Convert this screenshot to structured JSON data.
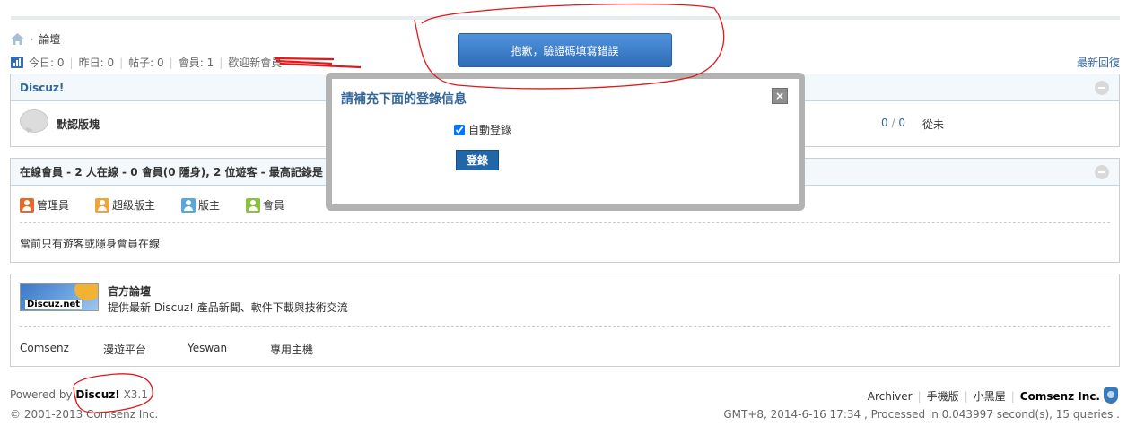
{
  "breadcrumb": {
    "home_icon": "home-icon",
    "separator": "›",
    "current": "論壇"
  },
  "stats": {
    "today_label": "今日:",
    "today": "0",
    "yesterday_label": "昨日:",
    "yesterday": "0",
    "posts_label": "帖子:",
    "posts": "0",
    "members_label": "會員:",
    "members": "1",
    "welcome": "歡迎新會員"
  },
  "latest_replies": "最新回復",
  "category": {
    "name": "Discuz!",
    "forum": {
      "name": "默認版塊",
      "threads": "0",
      "separator": "/",
      "posts": "0",
      "last_post": "從未"
    }
  },
  "online": {
    "header": "在線會員 - 2 人在線 - 0 會員(0 隱身), 2 位遊客 - 最高記錄是",
    "legend": [
      {
        "label": "管理員",
        "color": "#e8672a"
      },
      {
        "label": "超級版主",
        "color": "#f0a23c"
      },
      {
        "label": "版主",
        "color": "#5aa7de"
      },
      {
        "label": "會員",
        "color": "#8cc13f"
      }
    ],
    "message": "當前只有遊客或隱身會員在線"
  },
  "links": {
    "logo_text": "Discuz.net",
    "official_title": "官方論壇",
    "official_desc": "提供最新 Discuz! 產品新聞、軟件下載與技術交流",
    "items": [
      "Comsenz",
      "漫遊平台",
      "Yeswan",
      "專用主機"
    ]
  },
  "footer": {
    "powered_by": "Powered by",
    "brand": "Discuz!",
    "version": "X3.1",
    "copyright": "© 2001-2013 Comsenz Inc.",
    "right_links": [
      "Archiver",
      "手機版",
      "小黑屋"
    ],
    "company": "Comsenz Inc.",
    "server_info": "GMT+8, 2014-6-16 17:34 , Processed in 0.043997 second(s), 15 queries ."
  },
  "toast": {
    "message": "抱歉，驗證碼填寫錯誤"
  },
  "dialog": {
    "title": "請補充下面的登錄信息",
    "close": "×",
    "remember_label": "自動登錄",
    "remember_checked": true,
    "login_button": "登錄"
  },
  "colors": {
    "link_blue": "#336699",
    "button_blue": "#2366a8",
    "annotation_red": "#e0191b"
  }
}
